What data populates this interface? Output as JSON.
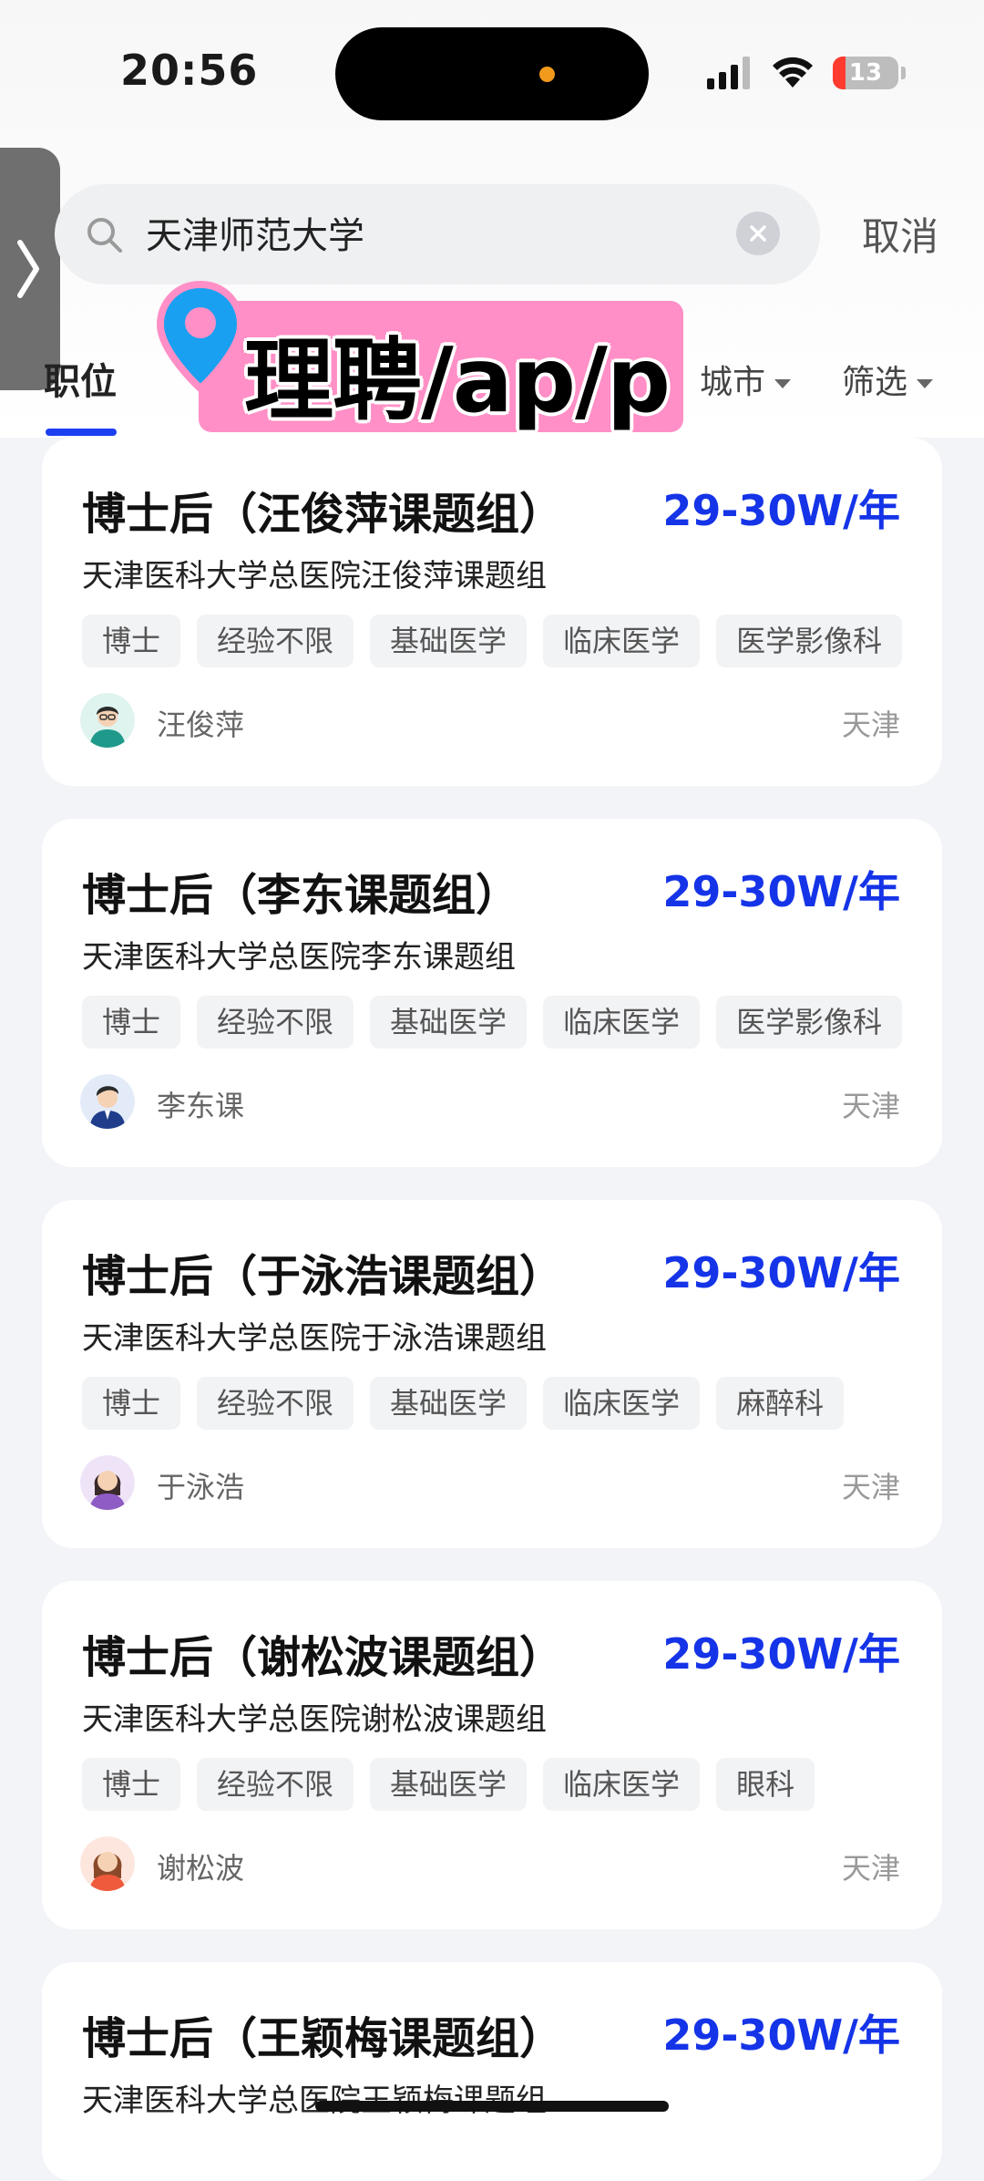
{
  "status_bar": {
    "time": "20:56",
    "battery": "13"
  },
  "search": {
    "query": "天津师范大学",
    "cancel_label": "取消"
  },
  "tabs": {
    "active_label": "职位"
  },
  "filters": {
    "city_label": "城市",
    "screen_label": "筛选"
  },
  "watermark": {
    "text": "理聘/ap/p"
  },
  "jobs": [
    {
      "title": "博士后（汪俊萍课题组）",
      "salary": "29-30W/年",
      "company": "天津医科大学总医院汪俊萍课题组",
      "tags": [
        "博士",
        "经验不限",
        "基础医学",
        "临床医学",
        "医学影像科"
      ],
      "person": "汪俊萍",
      "city": "天津"
    },
    {
      "title": "博士后（李东课题组）",
      "salary": "29-30W/年",
      "company": "天津医科大学总医院李东课题组",
      "tags": [
        "博士",
        "经验不限",
        "基础医学",
        "临床医学",
        "医学影像科"
      ],
      "person": "李东课",
      "city": "天津"
    },
    {
      "title": "博士后（于泳浩课题组）",
      "salary": "29-30W/年",
      "company": "天津医科大学总医院于泳浩课题组",
      "tags": [
        "博士",
        "经验不限",
        "基础医学",
        "临床医学",
        "麻醉科"
      ],
      "person": "于泳浩",
      "city": "天津"
    },
    {
      "title": "博士后（谢松波课题组）",
      "salary": "29-30W/年",
      "company": "天津医科大学总医院谢松波课题组",
      "tags": [
        "博士",
        "经验不限",
        "基础医学",
        "临床医学",
        "眼科"
      ],
      "person": "谢松波",
      "city": "天津"
    },
    {
      "title": "博士后（王颖梅课题组）",
      "salary": "29-30W/年",
      "company": "天津医科大学总医院王颖梅课题组",
      "tags": [],
      "person": "",
      "city": ""
    }
  ]
}
